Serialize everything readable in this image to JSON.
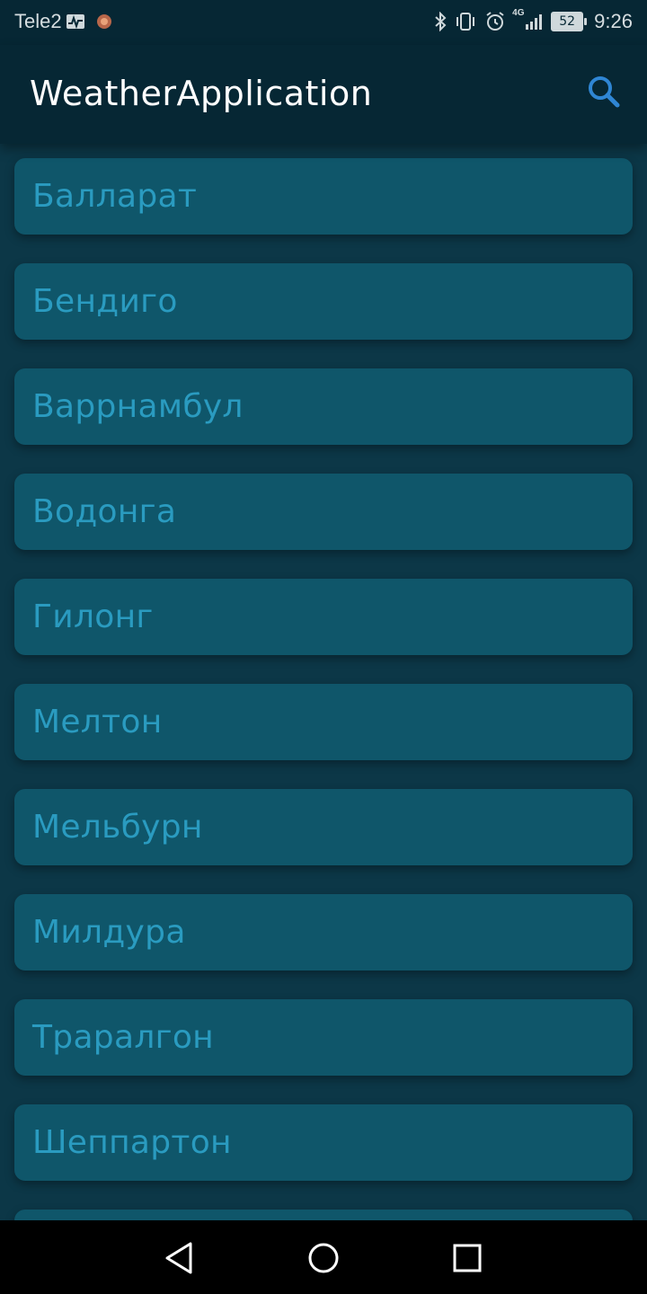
{
  "status_bar": {
    "carrier": "Tele2",
    "network": "4G",
    "battery": "52",
    "time": "9:26"
  },
  "app_bar": {
    "title": "WeatherApplication",
    "search_icon": "search-icon",
    "accent_color": "#2f86d4"
  },
  "cities": [
    {
      "name": "Балларат"
    },
    {
      "name": "Бендиго"
    },
    {
      "name": "Варрнамбул"
    },
    {
      "name": "Водонга"
    },
    {
      "name": "Гилонг"
    },
    {
      "name": "Мелтон"
    },
    {
      "name": "Мельбурн"
    },
    {
      "name": "Милдура"
    },
    {
      "name": "Траралгон"
    },
    {
      "name": "Шеппартон"
    },
    {
      "name": ""
    }
  ],
  "colors": {
    "background": "#0c3747",
    "app_bar": "#062734",
    "card": "#0f566a",
    "card_text": "#2a9bc0"
  },
  "nav_bar": {
    "back_icon": "back-triangle-icon",
    "home_icon": "home-circle-icon",
    "recents_icon": "recents-square-icon"
  }
}
